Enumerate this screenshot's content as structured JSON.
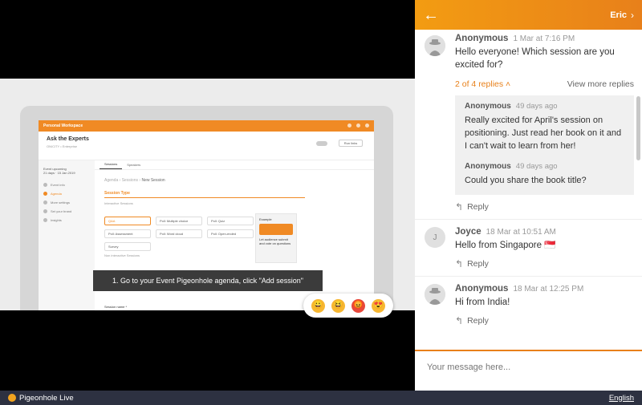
{
  "slide": {
    "workspace": "Personal Workspace",
    "event_title": "Ask the Experts",
    "event_status": "Event upcoming",
    "event_dates": "21 days · 15 Jan 2019",
    "button_label": "Test Mode",
    "btn2_label": "Run links",
    "sidebar": [
      "Event info",
      "Agenda",
      "More settings",
      "Set your brand",
      "Insights"
    ],
    "tabs": [
      "Sessions",
      "Speakers"
    ],
    "breadcrumb": [
      "Agenda",
      "Sessions",
      "New Session"
    ],
    "section_label": "Session Type",
    "interactive_label": "Interactive Sessions",
    "session_types": [
      "Q&A",
      "Poll: Multiple choice",
      "Poll: Quiz",
      "Poll: Assessment",
      "Poll: Word cloud",
      "Poll: Open-ended",
      "Survey"
    ],
    "non_interactive_label": "Non interactive Sessions",
    "example_title": "Example",
    "example_text": "Let audience submit and vote on questions",
    "session_name_label": "Session name *",
    "caption": "1. Go to your Event Pigeonhole agenda, click \"Add session\""
  },
  "reactions": [
    "😀",
    "😆",
    "😡",
    "😍"
  ],
  "panel": {
    "user": "Eric",
    "messages": [
      {
        "name": "Anonymous",
        "time": "1 Mar at 7:16 PM",
        "text": "Hello everyone! Which session are you excited for?",
        "reply_count": "2 of 4 replies",
        "view_more": "View more replies",
        "replies": [
          {
            "name": "Anonymous",
            "time": "49 days ago",
            "text": "Really excited for April's session on positioning. Just read her book on it and I can't wait to learn from her!"
          },
          {
            "name": "Anonymous",
            "time": "49 days ago",
            "text": "Could you share the book title?"
          }
        ],
        "reply_label": "Reply"
      },
      {
        "name": "Joyce",
        "initial": "J",
        "time": "18 Mar at 10:51 AM",
        "text": "Hello from Singapore 🇸🇬",
        "reply_label": "Reply"
      },
      {
        "name": "Anonymous",
        "time": "18 Mar at 12:25 PM",
        "text": "Hi from India!",
        "reply_label": "Reply"
      }
    ],
    "composer_placeholder": "Your message here..."
  },
  "footer": {
    "brand": "Pigeonhole Live",
    "language": "English"
  },
  "colors": {
    "accent": "#e8801a",
    "footer_bg": "#2d3141"
  }
}
